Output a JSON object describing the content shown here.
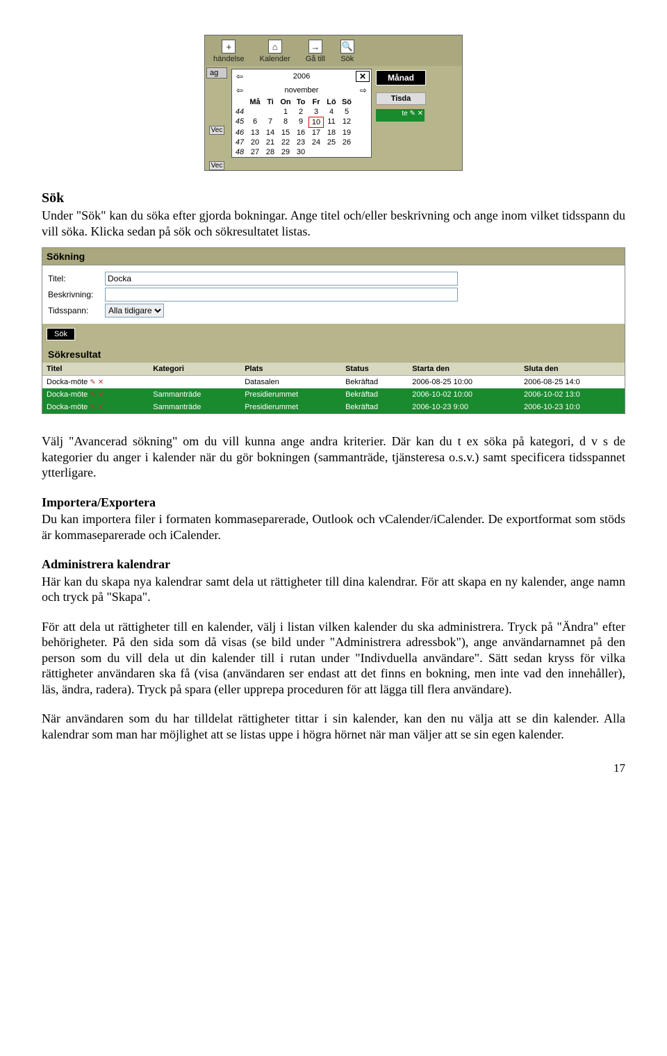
{
  "toolbar": {
    "items": [
      "händelse",
      "Kalender",
      "Gå till",
      "Sök"
    ],
    "icons": [
      "plus-icon",
      "home-icon",
      "goto-icon",
      "search-icon"
    ]
  },
  "ag_tab": "ag",
  "vec_label": "Vec",
  "datepicker": {
    "year": "2006",
    "month": "november",
    "weekdays": [
      "Må",
      "Ti",
      "On",
      "To",
      "Fr",
      "Lö",
      "Sö"
    ],
    "weeks": [
      {
        "wk": "44",
        "days": [
          "",
          "",
          "1",
          "2",
          "3",
          "4",
          "5"
        ]
      },
      {
        "wk": "45",
        "days": [
          "6",
          "7",
          "8",
          "9",
          "10",
          "11",
          "12"
        ]
      },
      {
        "wk": "46",
        "days": [
          "13",
          "14",
          "15",
          "16",
          "17",
          "18",
          "19"
        ]
      },
      {
        "wk": "47",
        "days": [
          "20",
          "21",
          "22",
          "23",
          "24",
          "25",
          "26"
        ]
      },
      {
        "wk": "48",
        "days": [
          "27",
          "28",
          "29",
          "30",
          "",
          "",
          ""
        ]
      }
    ],
    "today": "10"
  },
  "month_label": "Månad",
  "tisdag": "Tisda",
  "green_mark": "te ✎ ✕",
  "sok_heading": "Sök",
  "sok_intro": "Under \"Sök\" kan du söka efter gjorda bokningar. Ange titel och/eller beskrivning och ange inom vilket tidsspann du vill söka. Klicka sedan på sök och sökresultatet listas.",
  "search": {
    "panel_title": "Sökning",
    "titel_label": "Titel:",
    "titel_value": "Docka",
    "beskr_label": "Beskrivning:",
    "tids_label": "Tidsspann:",
    "tids_value": "Alla tidigare",
    "button": "Sök"
  },
  "results": {
    "heading": "Sökresultat",
    "cols": [
      "Titel",
      "Kategori",
      "Plats",
      "Status",
      "Starta den",
      "Sluta den"
    ],
    "rows": [
      {
        "style": "white",
        "titel": "Docka-möte",
        "kat": "",
        "plats": "Datasalen",
        "status": "Bekräftad",
        "start": "2006-08-25 10:00",
        "slut": "2006-08-25 14:0"
      },
      {
        "style": "green",
        "titel": "Docka-möte",
        "kat": "Sammanträde",
        "plats": "Presidierummet",
        "status": "Bekräftad",
        "start": "2006-10-02 10:00",
        "slut": "2006-10-02 13:0"
      },
      {
        "style": "green",
        "titel": "Docka-möte",
        "kat": "Sammanträde",
        "plats": "Presidierummet",
        "status": "Bekräftad",
        "start": "2006-10-23 9:00",
        "slut": "2006-10-23 10:0"
      }
    ]
  },
  "para1": "Välj \"Avancerad sökning\" om du vill kunna ange andra kriterier. Där kan du t ex söka på kategori, d v s de kategorier du anger i kalender när du gör bokningen  (sammanträde, tjänsteresa o.s.v.) samt specificera tidsspannet ytterligare.",
  "head_import": "Importera/Exportera",
  "para2": "Du kan importera filer i formaten kommaseparerade, Outlook och vCalender/iCalender. De exportformat som stöds är kommaseparerade och iCalender.",
  "head_admin": "Administrera kalendrar",
  "para3": "Här kan du skapa nya kalendrar samt dela ut rättigheter till dina kalendrar. För att skapa en ny kalender, ange namn och tryck på \"Skapa\".",
  "para4": "För att dela ut rättigheter till en kalender, välj i listan vilken kalender du ska administrera. Tryck på \"Ändra\" efter behörigheter. På den sida som då visas (se bild under \"Administrera adressbok\"), ange användarnamnet på den person som du vill dela ut din kalender till i rutan under \"Indivduella användare\". Sätt sedan kryss för vilka rättigheter användaren ska få (visa (användaren ser endast att det finns en bokning, men inte vad den innehåller), läs, ändra, radera). Tryck på spara (eller upprepa proceduren för att lägga till flera användare).",
  "para5": "När användaren som du har tilldelat rättigheter tittar i sin kalender, kan den nu välja att se din kalender. Alla kalendrar som man har möjlighet att se listas uppe i högra hörnet när man väljer att se sin egen kalender.",
  "page_number": "17"
}
